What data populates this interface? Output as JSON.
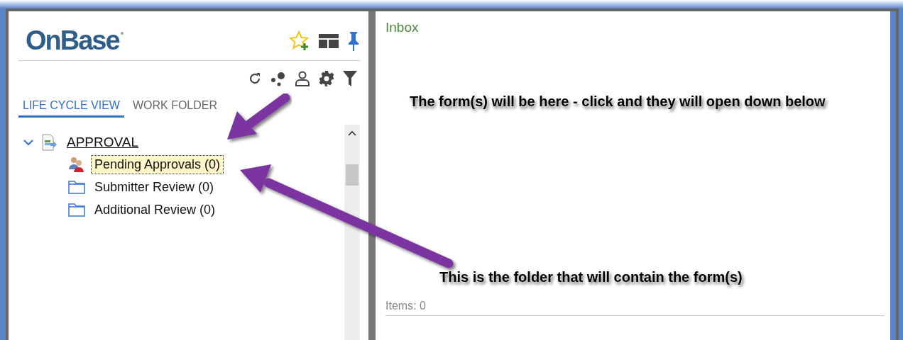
{
  "logo": "OnBase",
  "tabs": [
    {
      "label": "LIFE CYCLE VIEW",
      "selected": true
    },
    {
      "label": "WORK FOLDER",
      "selected": false
    }
  ],
  "tree": [
    {
      "label": "APPROVAL",
      "expanded": true,
      "children": [
        {
          "label": "Pending Approvals (0)",
          "kind": "queue",
          "selected": true
        },
        {
          "label": "Submitter Review (0)",
          "kind": "folder",
          "selected": false
        },
        {
          "label": "Additional Review (0)",
          "kind": "folder",
          "selected": false
        }
      ]
    }
  ],
  "inbox": {
    "title": "Inbox",
    "items": "Items: 0"
  },
  "annotations": [
    "The form(s) will be here - click and they will open down below",
    "This is the folder that will contain the form(s)"
  ]
}
